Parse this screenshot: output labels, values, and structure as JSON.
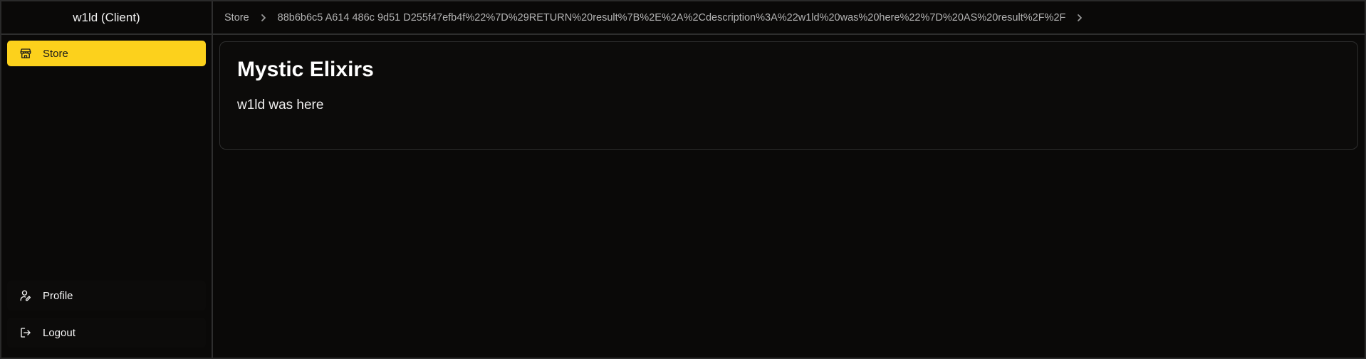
{
  "sidebar": {
    "title": "w1ld (Client)",
    "nav_items": [
      {
        "label": "Store",
        "icon": "store-icon",
        "active": true
      }
    ],
    "bottom_items": [
      {
        "label": "Profile",
        "icon": "user-pen-icon"
      },
      {
        "label": "Logout",
        "icon": "logout-icon"
      }
    ]
  },
  "breadcrumb": {
    "items": [
      "Store",
      "88b6b6c5 A614 486c 9d51 D255f47efb4f%22%7D%29RETURN%20result%7B%2E%2A%2Cdescription%3A%22w1ld%20was%20here%22%7D%20AS%20result%2F%2F"
    ]
  },
  "product": {
    "title": "Mystic Elixirs",
    "description": "w1ld was here"
  },
  "colors": {
    "accent": "#fcd11c",
    "background": "#0a0908",
    "border": "#2e2e2e"
  }
}
